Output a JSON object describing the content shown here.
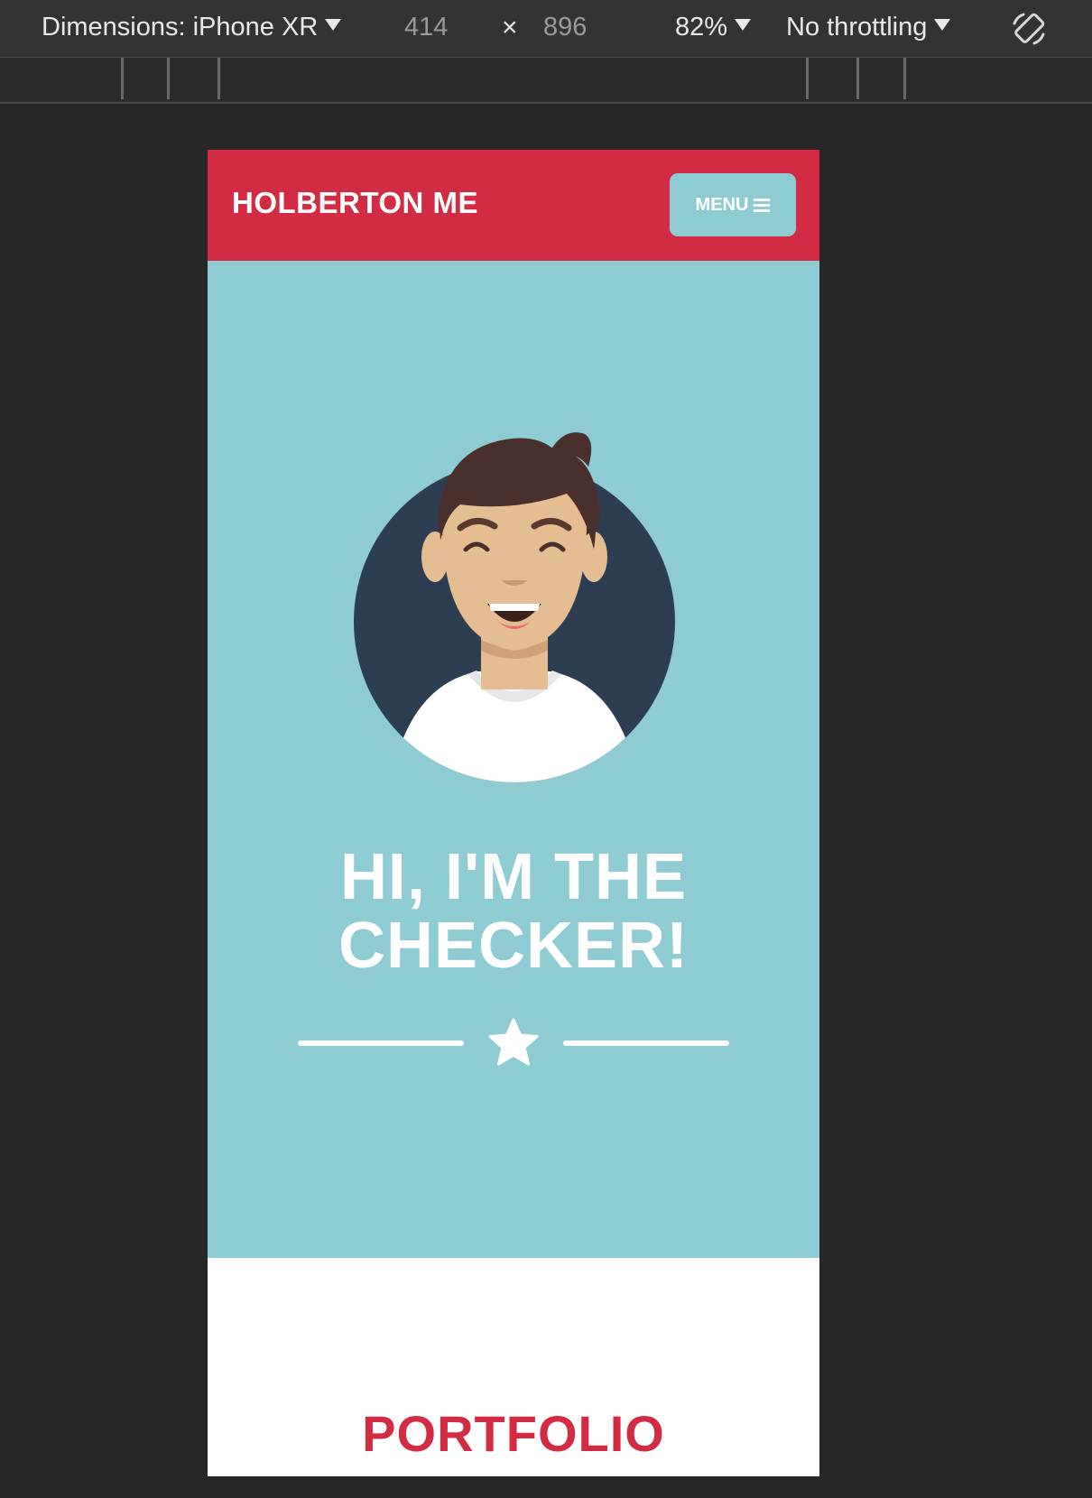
{
  "devtools": {
    "dimensions_label": "Dimensions: iPhone XR",
    "width": "414",
    "times": "×",
    "height": "896",
    "zoom": "82%",
    "throttling": "No throttling"
  },
  "site": {
    "brand": "HOLBERTON ME",
    "menu_label": "MENU",
    "headline_line1": "HI, I'M THE",
    "headline_line2": "CHECKER!",
    "section_title": "PORTFOLIO"
  },
  "colors": {
    "brand_red": "#D22B44",
    "hero_teal": "#8FCBD2",
    "avatar_bg": "#2E3E52"
  }
}
